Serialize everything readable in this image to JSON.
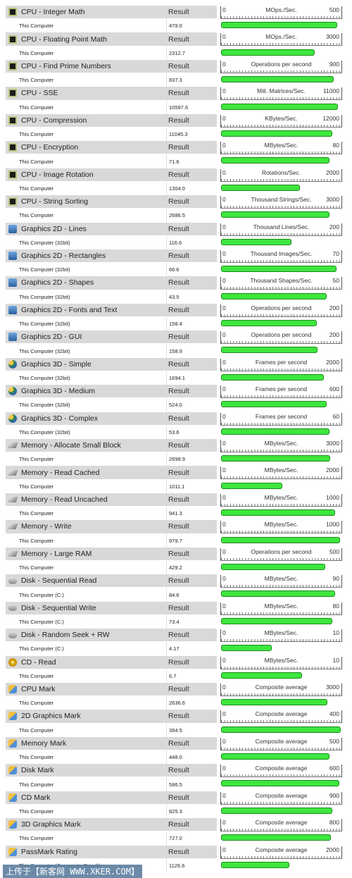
{
  "result_label": "Result",
  "bar_color": "#3ee63e",
  "watermark": "上传于【新客网 WWW.XKER.COM】",
  "tests": [
    {
      "name": "CPU - Integer Math",
      "icon": "cpu",
      "sub": "This Computer",
      "value": "479.0",
      "unit": "MOps./Sec.",
      "min": "0",
      "max": "500"
    },
    {
      "name": "CPU - Floating Point Math",
      "icon": "cpu",
      "sub": "This Computer",
      "value": "2312.7",
      "unit": "MOps./Sec.",
      "min": "0",
      "max": "3000"
    },
    {
      "name": "CPU - Find Prime Numbers",
      "icon": "cpu",
      "sub": "This Computer",
      "value": "837.3",
      "unit": "Operations per second",
      "min": "0",
      "max": "900"
    },
    {
      "name": "CPU - SSE",
      "icon": "cpu",
      "sub": "This Computer",
      "value": "10597.6",
      "unit": "Mill. Matrices/Sec.",
      "min": "0",
      "max": "11000"
    },
    {
      "name": "CPU - Compression",
      "icon": "cpu",
      "sub": "This Computer",
      "value": "11045.3",
      "unit": "KBytes/Sec.",
      "min": "0",
      "max": "12000"
    },
    {
      "name": "CPU - Encryption",
      "icon": "cpu",
      "sub": "This Computer",
      "value": "71.6",
      "unit": "MBytes/Sec.",
      "min": "0",
      "max": "80"
    },
    {
      "name": "CPU - Image Rotation",
      "icon": "cpu",
      "sub": "This Computer",
      "value": "1304.0",
      "unit": "Rotations/Sec.",
      "min": "0",
      "max": "2000"
    },
    {
      "name": "CPU - String Sorting",
      "icon": "cpu",
      "sub": "This Computer",
      "value": "2686.5",
      "unit": "Thousand Strings/Sec.",
      "min": "0",
      "max": "3000"
    },
    {
      "name": "Graphics 2D - Lines",
      "icon": "g2d",
      "sub": "This Computer (32bit)",
      "value": "116.6",
      "unit": "Thousand Lines/Sec.",
      "min": "0",
      "max": "200"
    },
    {
      "name": "Graphics 2D - Rectangles",
      "icon": "g2d",
      "sub": "This Computer (32bit)",
      "value": "66.6",
      "unit": "Thousand Images/Sec.",
      "min": "0",
      "max": "70"
    },
    {
      "name": "Graphics 2D - Shapes",
      "icon": "g2d",
      "sub": "This Computer (32bit)",
      "value": "43.5",
      "unit": "Thousand Shapes/Sec.",
      "min": "0",
      "max": "50"
    },
    {
      "name": "Graphics 2D - Fonts and Text",
      "icon": "g2d",
      "sub": "This Computer (32bit)",
      "value": "158.4",
      "unit": "Operations per second",
      "min": "0",
      "max": "200"
    },
    {
      "name": "Graphics 2D - GUI",
      "icon": "g2d",
      "sub": "This Computer (32bit)",
      "value": "158.9",
      "unit": "Operations per second",
      "min": "0",
      "max": "200"
    },
    {
      "name": "Graphics 3D - Simple",
      "icon": "g3d",
      "sub": "This Computer (32bit)",
      "value": "1694.1",
      "unit": "Frames per second",
      "min": "0",
      "max": "2000"
    },
    {
      "name": "Graphics 3D - Medium",
      "icon": "g3d",
      "sub": "This Computer (32bit)",
      "value": "524.0",
      "unit": "Frames per second",
      "min": "0",
      "max": "600"
    },
    {
      "name": "Graphics 3D - Complex",
      "icon": "g3d",
      "sub": "This Computer (32bit)",
      "value": "53.6",
      "unit": "Frames per second",
      "min": "0",
      "max": "60"
    },
    {
      "name": "Memory - Allocate Small Block",
      "icon": "mem",
      "sub": "This Computer",
      "value": "2698.9",
      "unit": "MBytes/Sec.",
      "min": "0",
      "max": "3000"
    },
    {
      "name": "Memory - Read Cached",
      "icon": "mem",
      "sub": "This Computer",
      "value": "1011.1",
      "unit": "MBytes/Sec.",
      "min": "0",
      "max": "2000"
    },
    {
      "name": "Memory - Read Uncached",
      "icon": "mem",
      "sub": "This Computer",
      "value": "941.3",
      "unit": "MBytes/Sec.",
      "min": "0",
      "max": "1000"
    },
    {
      "name": "Memory - Write",
      "icon": "mem",
      "sub": "This Computer",
      "value": "979.7",
      "unit": "MBytes/Sec.",
      "min": "0",
      "max": "1000"
    },
    {
      "name": "Memory - Large RAM",
      "icon": "mem",
      "sub": "This Computer",
      "value": "429.2",
      "unit": "Operations per second",
      "min": "0",
      "max": "500"
    },
    {
      "name": "Disk - Sequential Read",
      "icon": "disk",
      "sub": "This Computer (C:)",
      "value": "84.6",
      "unit": "MBytes/Sec.",
      "min": "0",
      "max": "90"
    },
    {
      "name": "Disk - Sequential Write",
      "icon": "disk",
      "sub": "This Computer (C:)",
      "value": "73.4",
      "unit": "MBytes/Sec.",
      "min": "0",
      "max": "80"
    },
    {
      "name": "Disk - Random Seek + RW",
      "icon": "disk",
      "sub": "This Computer (C:)",
      "value": "4.17",
      "unit": "MBytes/Sec.",
      "min": "0",
      "max": "10"
    },
    {
      "name": "CD - Read",
      "icon": "cd",
      "sub": "This Computer",
      "value": "6.7",
      "unit": "MBytes/Sec.",
      "min": "0",
      "max": "10"
    },
    {
      "name": "CPU Mark",
      "icon": "mark",
      "sub": "This Computer",
      "value": "2636.6",
      "unit": "Composite average",
      "min": "0",
      "max": "3000"
    },
    {
      "name": "2D Graphics Mark",
      "icon": "mark",
      "sub": "This Computer",
      "value": "394.5",
      "unit": "Composite average",
      "min": "0",
      "max": "400"
    },
    {
      "name": "Memory Mark",
      "icon": "mark",
      "sub": "This Computer",
      "value": "448.0",
      "unit": "Composite average",
      "min": "0",
      "max": "500"
    },
    {
      "name": "Disk Mark",
      "icon": "mark",
      "sub": "This Computer",
      "value": "586.5",
      "unit": "Composite average",
      "min": "0",
      "max": "600"
    },
    {
      "name": "CD Mark",
      "icon": "mark",
      "sub": "This Computer",
      "value": "825.3",
      "unit": "Composite average",
      "min": "0",
      "max": "900"
    },
    {
      "name": "3D Graphics Mark",
      "icon": "mark",
      "sub": "This Computer",
      "value": "727.0",
      "unit": "Composite average",
      "min": "0",
      "max": "800"
    },
    {
      "name": "PassMark Rating",
      "icon": "mark",
      "sub": "This Computer (Composite Result)",
      "value": "1126.6",
      "unit": "Composite average",
      "min": "0",
      "max": "2000"
    }
  ]
}
